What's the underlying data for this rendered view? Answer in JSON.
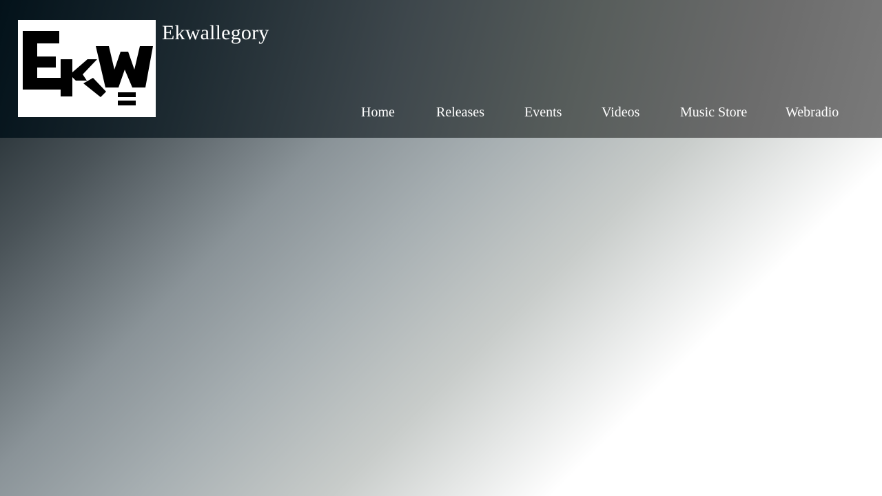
{
  "site": {
    "title": "Ekwallegory",
    "logo_text": "EKW"
  },
  "nav": {
    "items": [
      {
        "label": "Home"
      },
      {
        "label": "Releases"
      },
      {
        "label": "Events"
      },
      {
        "label": "Videos"
      },
      {
        "label": "Music Store"
      },
      {
        "label": "Webradio"
      }
    ]
  },
  "colors": {
    "header_start": "#03121a",
    "header_end": "#7a7a7a",
    "text": "#ffffff",
    "logo_bg": "#ffffff",
    "logo_fg": "#000000"
  }
}
